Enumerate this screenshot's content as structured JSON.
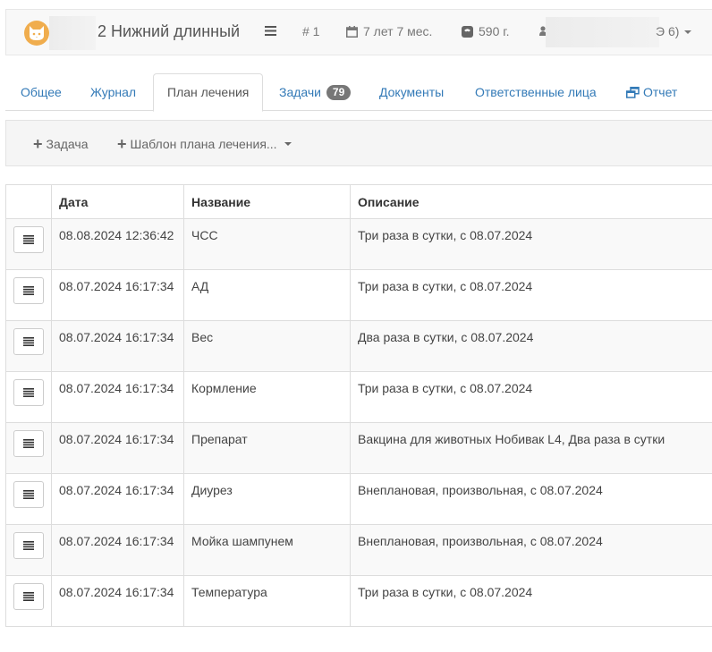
{
  "header": {
    "pet_name": "2 Нижний длинный",
    "pet_number": "# 1",
    "pet_age": "7 лет 7 мес.",
    "pet_weight": "590 г.",
    "user_tail": "Э 6)"
  },
  "tabs": [
    {
      "label": "Общее",
      "active": false
    },
    {
      "label": "Журнал",
      "active": false
    },
    {
      "label": "План лечения",
      "active": true
    },
    {
      "label": "Задачи",
      "badge": "79",
      "active": false
    },
    {
      "label": "Документы",
      "active": false
    },
    {
      "label": "Ответственные лица",
      "active": false
    },
    {
      "label": "Отчет",
      "active": false
    }
  ],
  "toolbar": {
    "add_task_label": "Задача",
    "template_label": "Шаблон плана лечения..."
  },
  "table": {
    "headers": [
      "",
      "Дата",
      "Название",
      "Описание"
    ],
    "rows": [
      {
        "date": "08.08.2024 12:36:42",
        "name": "ЧСС",
        "description": "Три раза в сутки, с 08.07.2024"
      },
      {
        "date": "08.07.2024 16:17:34",
        "name": "АД",
        "description": "Три раза в сутки, с 08.07.2024"
      },
      {
        "date": "08.07.2024 16:17:34",
        "name": "Вес",
        "description": "Два раза в сутки, с 08.07.2024"
      },
      {
        "date": "08.07.2024 16:17:34",
        "name": "Кормление",
        "description": "Три раза в сутки, с 08.07.2024"
      },
      {
        "date": "08.07.2024 16:17:34",
        "name": "Препарат",
        "description": "Вакцина для животных Нобивак L4, Два раза в сутки"
      },
      {
        "date": "08.07.2024 16:17:34",
        "name": "Диурез",
        "description": "Внеплановая, произвольная, с 08.07.2024"
      },
      {
        "date": "08.07.2024 16:17:34",
        "name": "Мойка шампунем",
        "description": "Внеплановая, произвольная, с 08.07.2024"
      },
      {
        "date": "08.07.2024 16:17:34",
        "name": "Температура",
        "description": "Три раза в сутки, с 08.07.2024"
      }
    ]
  },
  "colors": {
    "link": "#337ab7",
    "avatar": "#f0ad4e",
    "badge": "#777777"
  }
}
